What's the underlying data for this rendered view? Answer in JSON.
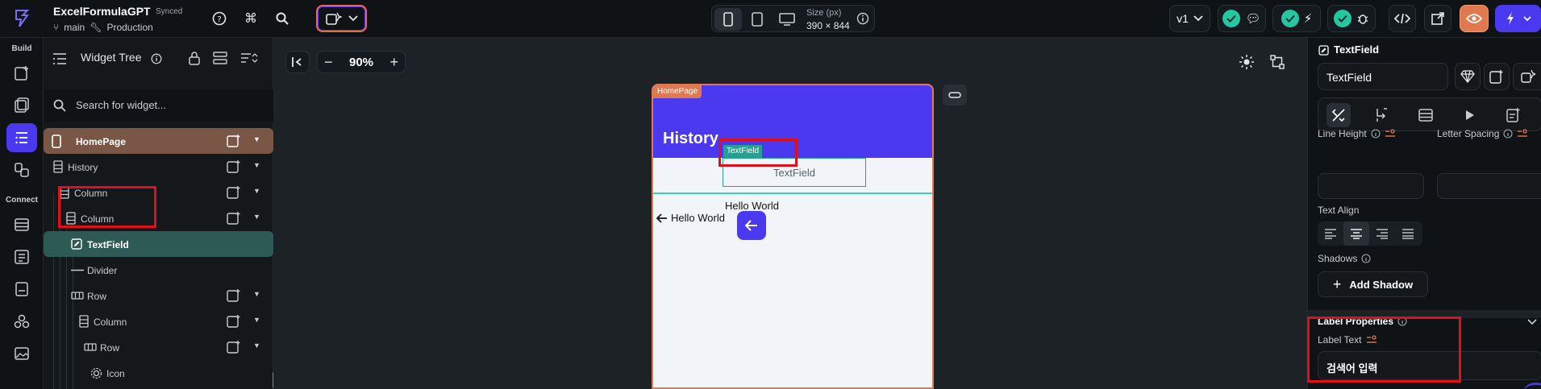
{
  "topbar": {
    "project_name": "ExcelFormulaGPT",
    "sync_status": "Synced",
    "branch": "main",
    "environment": "Production",
    "size_label": "Size (px)",
    "size_value": "390 × 844",
    "version": "v1",
    "icons": [
      "help-icon",
      "command-icon",
      "search-icon",
      "ai-widget-icon",
      "phone-icon",
      "tablet-icon",
      "desktop-icon",
      "info-icon",
      "chat-check-icon",
      "flash-check-icon",
      "bug-check-icon",
      "code-icon",
      "open-external-icon",
      "preview-eye-icon",
      "run-lightning-icon"
    ]
  },
  "rail": {
    "build_label": "Build",
    "connect_label": "Connect"
  },
  "tree": {
    "title": "Widget Tree",
    "search_placeholder": "Search for widget...",
    "rows": [
      {
        "label": "HomePage"
      },
      {
        "label": "History"
      },
      {
        "label": "Column"
      },
      {
        "label": "Column"
      },
      {
        "label": "TextField"
      },
      {
        "label": "Divider"
      },
      {
        "label": "Row"
      },
      {
        "label": "Column"
      },
      {
        "label": "Row"
      },
      {
        "label": "Icon"
      }
    ]
  },
  "canvas": {
    "zoom": "90%",
    "page_tag": "HomePage",
    "appbar_title": "History",
    "textfield_tag": "TextField",
    "textfield_label": "TextField",
    "hello_1": "Hello World",
    "hello_2": "Hello World"
  },
  "props": {
    "widget_type": "TextField",
    "widget_name": "TextField",
    "line_height_label": "Line Height",
    "letter_spacing_label": "Letter Spacing",
    "text_align_label": "Text Align",
    "shadows_label": "Shadows",
    "add_shadow_label": "Add Shadow",
    "label_properties_label": "Label Properties",
    "label_text_label": "Label Text",
    "label_text_value": "검색어 입력"
  },
  "colors": {
    "primary": "#4b39ef",
    "selection_teal": "#2d5a55",
    "homepage_row": "#7a5647",
    "annotation_red": "#e0101a"
  }
}
